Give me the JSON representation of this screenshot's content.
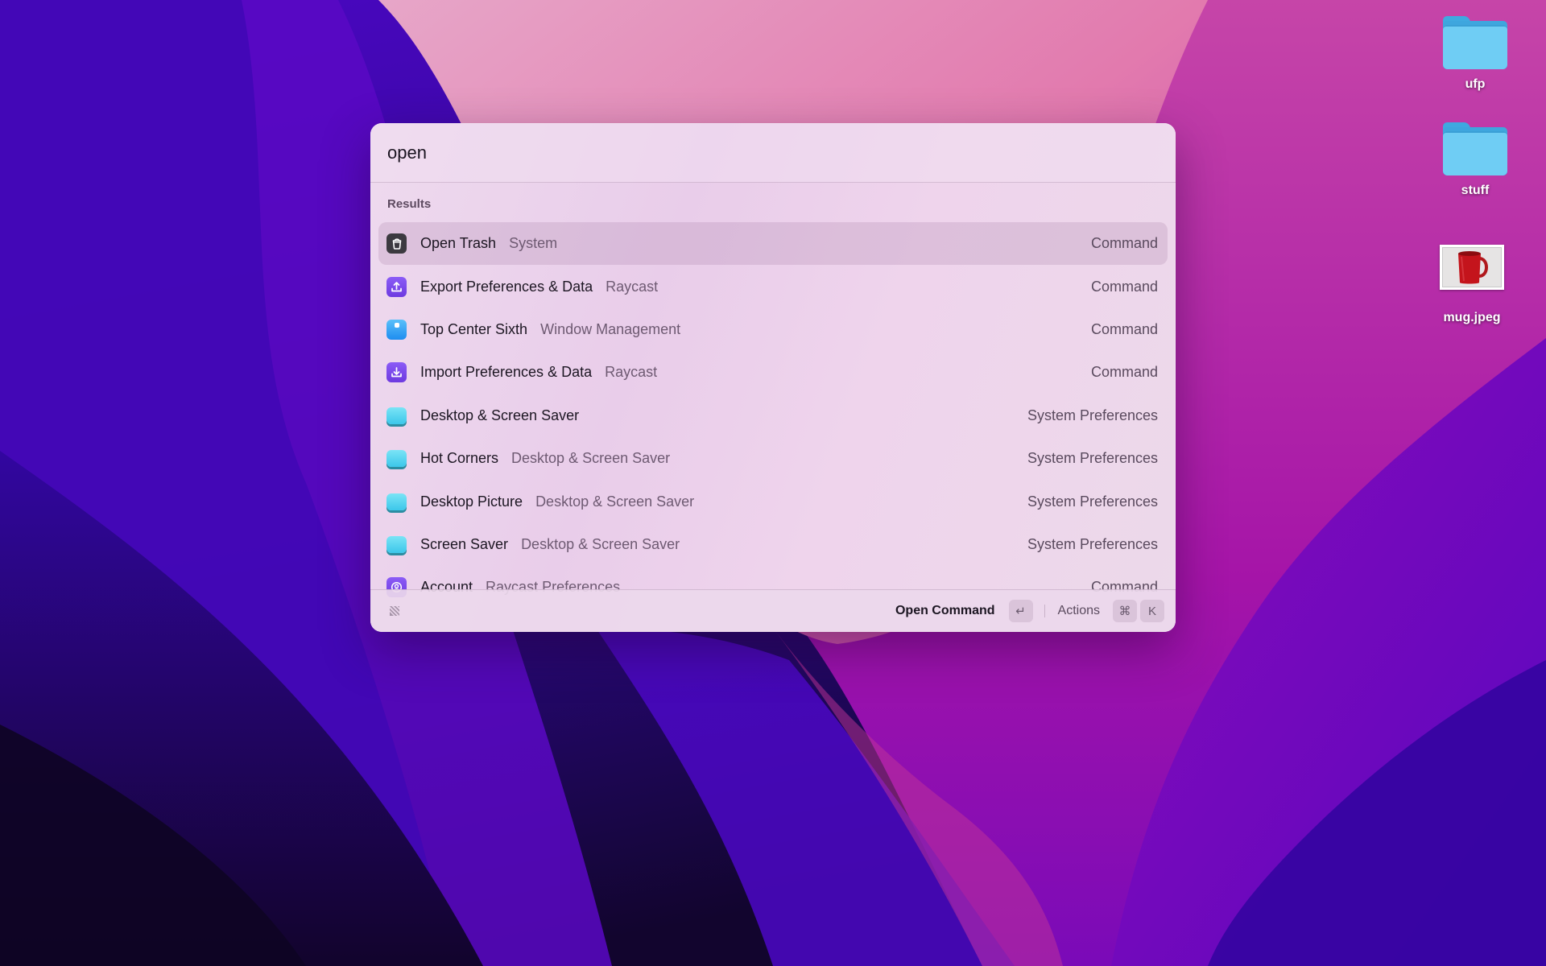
{
  "desktop": {
    "wallpaper": {
      "colors": [
        "#1a0640",
        "#3a06a8",
        "#7a0cba",
        "#b318a8",
        "#e07cb0",
        "#f1a0c4"
      ]
    },
    "items": [
      {
        "label": "ufp",
        "type": "folder",
        "icon": "folder-icon"
      },
      {
        "label": "stuff",
        "type": "folder",
        "icon": "folder-icon"
      },
      {
        "label": "mug.jpeg",
        "type": "image",
        "icon": "image-thumbnail-icon"
      }
    ]
  },
  "raycast": {
    "search": {
      "value": "open",
      "placeholder": ""
    },
    "section_title": "Results",
    "results": [
      {
        "title": "Open Trash",
        "subtitle": "System",
        "accessory": "Command",
        "icon": "trash-icon",
        "selected": true
      },
      {
        "title": "Export Preferences & Data",
        "subtitle": "Raycast",
        "accessory": "Command",
        "icon": "upload-icon",
        "selected": false
      },
      {
        "title": "Top Center Sixth",
        "subtitle": "Window Management",
        "accessory": "Command",
        "icon": "window-management-icon",
        "selected": false
      },
      {
        "title": "Import Preferences & Data",
        "subtitle": "Raycast",
        "accessory": "Command",
        "icon": "download-icon",
        "selected": false
      },
      {
        "title": "Desktop & Screen Saver",
        "subtitle": "",
        "accessory": "System Preferences",
        "icon": "desktop-screen-saver-icon",
        "selected": false
      },
      {
        "title": "Hot Corners",
        "subtitle": "Desktop & Screen Saver",
        "accessory": "System Preferences",
        "icon": "desktop-screen-saver-icon",
        "selected": false
      },
      {
        "title": "Desktop Picture",
        "subtitle": "Desktop & Screen Saver",
        "accessory": "System Preferences",
        "icon": "desktop-screen-saver-icon",
        "selected": false
      },
      {
        "title": "Screen Saver",
        "subtitle": "Desktop & Screen Saver",
        "accessory": "System Preferences",
        "icon": "desktop-screen-saver-icon",
        "selected": false
      },
      {
        "title": "Account",
        "subtitle": "Raycast Preferences",
        "accessory": "Command",
        "icon": "account-icon",
        "selected": false
      }
    ],
    "footer": {
      "primary_action": "Open Command",
      "primary_key": "↵",
      "actions_label": "Actions",
      "actions_keys": [
        "⌘",
        "K"
      ]
    }
  }
}
